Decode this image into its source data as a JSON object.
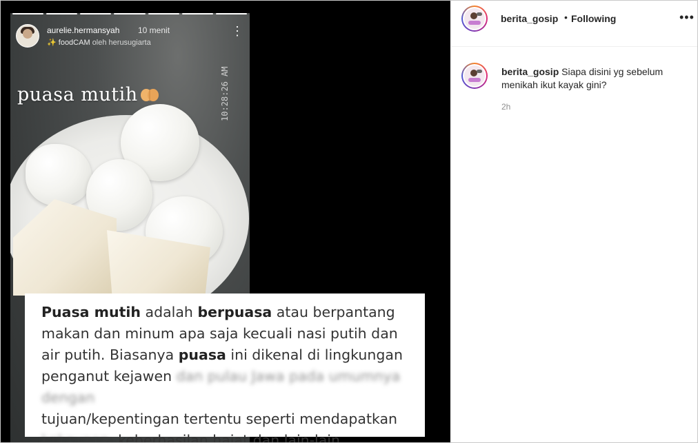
{
  "story": {
    "username": "aurelie.hermansyah",
    "time_ago": "10 menit",
    "filter_name": "foodCAM",
    "filter_by": "oleh herusugiarta",
    "overlay_title": "puasa mutih",
    "timestamp": "10:28:26 AM",
    "progress_segments": 7
  },
  "caption_card": {
    "lines": [
      [
        {
          "t": "Puasa mutih",
          "b": true
        },
        {
          "t": " adalah "
        },
        {
          "t": "berpuasa",
          "b": true
        },
        {
          "t": " atau berpantang"
        }
      ],
      [
        {
          "t": "makan dan minum apa saja kecuali nasi putih dan"
        }
      ],
      [
        {
          "t": "air putih. Biasanya "
        },
        {
          "t": "puasa",
          "b": true
        },
        {
          "t": " ini dikenal di lingkungan"
        }
      ],
      [
        {
          "t": "penganut kejawen "
        },
        {
          "t": "dan pulau Jawa pada umumnya dengan",
          "blur": true
        }
      ],
      [
        {
          "t": "tujuan/kepentingan tertentu seperti mendapatkan"
        }
      ],
      [
        {
          "t": "kekayaan,",
          "blur": true
        },
        {
          "t": " keberhasilan hajat dan lain-lain."
        }
      ]
    ]
  },
  "post": {
    "account": "berita_gosip",
    "separator": "•",
    "follow_status": "Following",
    "more_icon": "more-horizontal-icon",
    "caption_text": "Siapa disini yg sebelum menikah ikut kayak gini?",
    "posted_ago": "2h"
  },
  "colors": {
    "story_background": "#000000",
    "sidebar_background": "#ffffff",
    "username_text": "#262626",
    "muted_text": "#8e8e8e",
    "avatar_ring": [
      "#f58529",
      "#dd2a7b",
      "#8134af",
      "#515bd4"
    ]
  }
}
